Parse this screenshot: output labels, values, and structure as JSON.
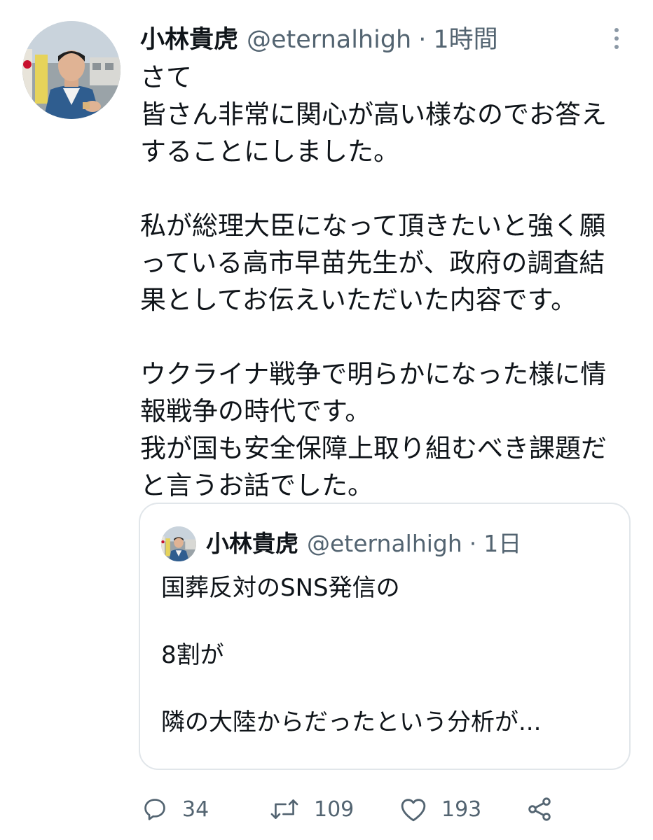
{
  "tweet": {
    "display_name": "小林貴虎",
    "handle": "@eternalhigh",
    "separator": "·",
    "time": "1時間",
    "body_lines": [
      "さて",
      "皆さん非常に関心が高い様なのでお答え",
      "することにしました。",
      "",
      "私が総理大臣になって頂きたいと強く願",
      "っている高市早苗先生が、政府の調査結",
      "果としてお伝えいただいた内容です。",
      "",
      "ウクライナ戦争で明らかになった様に情",
      "報戦争の時代です。",
      "我が国も安全保障上取り組むべき課題だ",
      "と言うお話でした。"
    ]
  },
  "quoted_tweet": {
    "display_name": "小林貴虎",
    "handle": "@eternalhigh",
    "separator": "·",
    "time": "1日",
    "body_lines": [
      "国葬反対のSNS発信の",
      "",
      "8割が",
      "",
      "隣の大陸からだったという分析が..."
    ]
  },
  "actions": {
    "reply_count": "34",
    "retweet_count": "109",
    "like_count": "193"
  },
  "icons": {
    "more": "more-vertical-icon",
    "reply": "reply-icon",
    "retweet": "retweet-icon",
    "like": "heart-icon",
    "share": "share-icon"
  },
  "colors": {
    "text_primary": "#0f1419",
    "text_secondary": "#536471",
    "border": "#e1e6ea"
  }
}
